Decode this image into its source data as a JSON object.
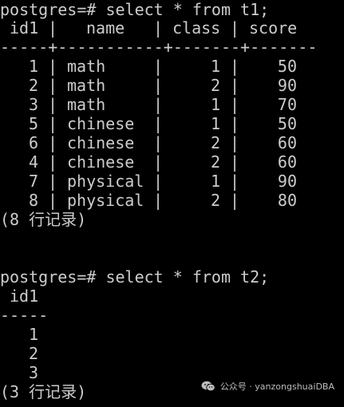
{
  "theme": {
    "background": "#000000",
    "foreground": "#cccccc"
  },
  "query1": {
    "prompt": "postgres=# select * from t1;",
    "headers": {
      "id1": "id1",
      "name": "name",
      "class": "class",
      "score": "score"
    },
    "separator": "-----+-----------+-------+-------",
    "rows": [
      {
        "id1": "1",
        "name": "math",
        "class": "1",
        "score": "50"
      },
      {
        "id1": "2",
        "name": "math",
        "class": "2",
        "score": "90"
      },
      {
        "id1": "3",
        "name": "math",
        "class": "1",
        "score": "70"
      },
      {
        "id1": "5",
        "name": "chinese",
        "class": "1",
        "score": "50"
      },
      {
        "id1": "6",
        "name": "chinese",
        "class": "2",
        "score": "60"
      },
      {
        "id1": "4",
        "name": "chinese",
        "class": "2",
        "score": "60"
      },
      {
        "id1": "7",
        "name": "physical",
        "class": "1",
        "score": "90"
      },
      {
        "id1": "8",
        "name": "physical",
        "class": "2",
        "score": "80"
      }
    ],
    "footer": "(8 行记录)"
  },
  "query2": {
    "prompt": "postgres=# select * from t2;",
    "header": "id1",
    "separator": "-----",
    "rows": [
      "1",
      "2",
      "3"
    ],
    "footer": "(3 行记录)"
  },
  "watermark": {
    "icon": "wechat-icon",
    "text": "公众号 · yanzongshuaiDBA"
  }
}
